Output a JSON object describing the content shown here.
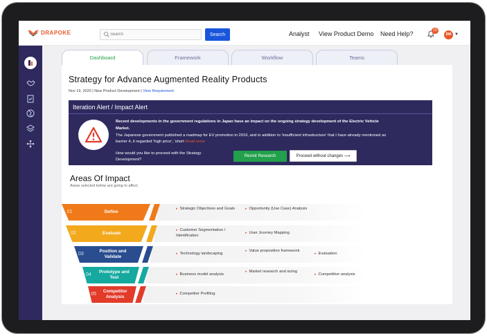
{
  "header": {
    "brand": "DRAPOKE",
    "search_placeholder": "Search",
    "search_button": "Search",
    "nav": [
      "Analyst",
      "View Product Demo",
      "Need Help?"
    ],
    "notification_count": "15",
    "avatar_initials": "DM"
  },
  "sidebar": {
    "items": [
      "profile-icon",
      "handshake-icon",
      "clipboard-check-icon",
      "globe-icon",
      "layers-icon",
      "hierarchy-icon"
    ]
  },
  "tabs": [
    "Dashboard",
    "Framework",
    "Workflow",
    "Teams"
  ],
  "page": {
    "title": "Strategy for Advance Augmented Reality Products",
    "meta_date": "Nov 19, 2020 | New Product Development |",
    "meta_link": "View Requirement"
  },
  "alert": {
    "heading": "Iteration Alert / Impact Alert",
    "text_bold": "Recent developments in the government regulations in Japan have an impact on the ongoing strategy development of the Electric Vehicle Market.",
    "text_body": "The Japanese government published a roadmap for EV promotion in 2016, and in addition to 'insufficient infrastructure' that I have already mentioned as barrier 4, it regarded 'high price', 'short",
    "read_more": "Read more",
    "question": "How would you like to proceed with the Strategy Development?",
    "revisit_button": "Revisit Research",
    "proceed_button": "Proceed without changes ⟶"
  },
  "areas": {
    "title": "Areas Of Impact",
    "subtitle": "Areas selected below are going to affect",
    "stages": [
      {
        "num": "01",
        "label": "Define",
        "color": "#f07a1a",
        "impacts": [
          "Strategic Objectives and Goals",
          "Opportunity (Use Case) Analysis"
        ]
      },
      {
        "num": "02",
        "label": "Evaluate",
        "color": "#f2a91c",
        "impacts": [
          "Customer Segmentation / Identification",
          "User Journey Mapping"
        ]
      },
      {
        "num": "03",
        "label": "Position and Validate",
        "color": "#2a4d8f",
        "impacts": [
          "Technology landscaping",
          "Value proposition framework",
          "Evaluation"
        ]
      },
      {
        "num": "04",
        "label": "Prototype and Test",
        "color": "#16a9a0",
        "impacts": [
          "Business model analysis",
          "Market research and sizing",
          "Competitive analysis"
        ]
      },
      {
        "num": "05",
        "label": "Competitor Analysis",
        "color": "#e23b2a",
        "impacts": [
          "Competitor Profiling"
        ]
      }
    ]
  }
}
